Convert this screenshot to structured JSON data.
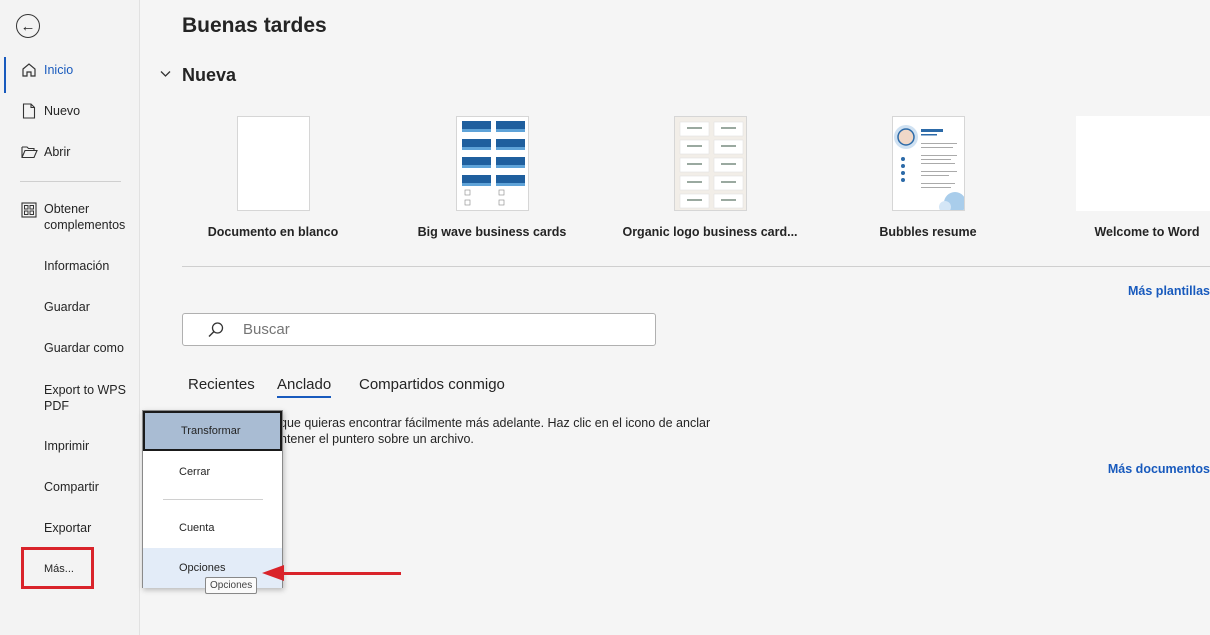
{
  "sidebar": {
    "items": [
      {
        "label": "Inicio"
      },
      {
        "label": "Nuevo"
      },
      {
        "label": "Abrir"
      },
      {
        "label": "Obtener complementos"
      },
      {
        "label": "Información"
      },
      {
        "label": "Guardar"
      },
      {
        "label": "Guardar como"
      },
      {
        "label": "Export to WPS PDF"
      },
      {
        "label": "Imprimir"
      },
      {
        "label": "Compartir"
      },
      {
        "label": "Exportar"
      },
      {
        "label": "Más..."
      }
    ]
  },
  "main": {
    "greeting": "Buenas tardes",
    "section_title": "Nueva",
    "templates": [
      {
        "name": "Documento en blanco"
      },
      {
        "name": "Big wave business cards"
      },
      {
        "name": "Organic logo business card..."
      },
      {
        "name": "Bubbles resume"
      },
      {
        "name": "Welcome to Word"
      }
    ],
    "more_templates": "Más plantillas",
    "search": {
      "placeholder": "Buscar"
    },
    "tabs": [
      {
        "label": "Recientes"
      },
      {
        "label": "Anclado"
      },
      {
        "label": "Compartidos conmigo"
      }
    ],
    "pinned_info_line1": "que quieras encontrar fácilmente más adelante. Haz clic en el icono de anclar",
    "pinned_info_line2": "ntener el puntero sobre un archivo.",
    "more_documents": "Más documentos"
  },
  "popup": {
    "items": [
      {
        "label": "Transformar"
      },
      {
        "label": "Cerrar"
      },
      {
        "label": "Cuenta"
      },
      {
        "label": "Opciones"
      }
    ],
    "tooltip": "Opciones"
  },
  "colors": {
    "accent": "#185abd",
    "annotation_red": "#d9232a"
  }
}
